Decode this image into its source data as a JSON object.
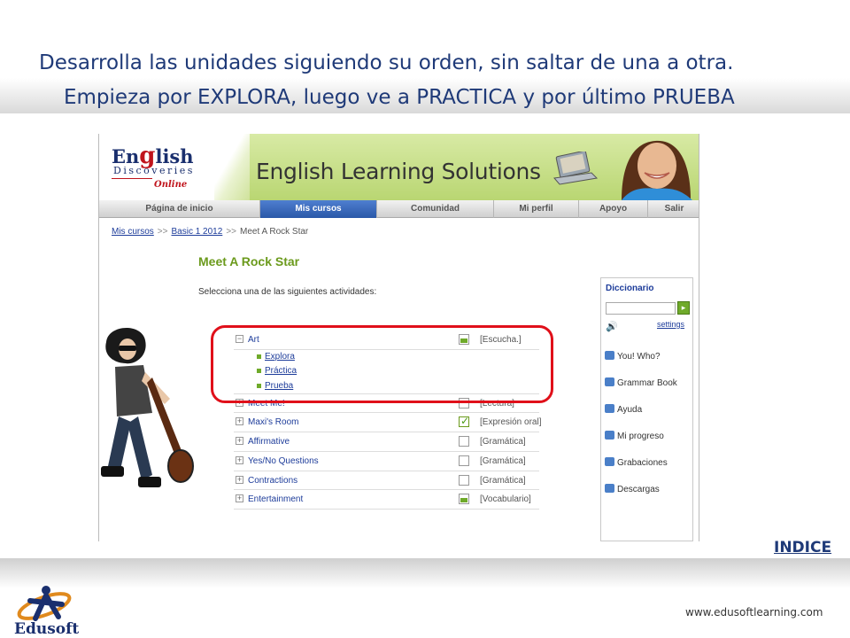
{
  "slide": {
    "title_line1": "Desarrolla las unidades siguiendo su orden, sin saltar de una a otra.",
    "title_line2": "Empieza por EXPLORA, luego ve a PRACTICA y por último PRUEBA",
    "indice": "INDICE",
    "url": "www.edusoftlearning.com",
    "edusoft_label": "Edusoft"
  },
  "header": {
    "logo_english_pre": "En",
    "logo_english_g": "g",
    "logo_english_post": "lish",
    "logo_discoveries": "Discoveries",
    "logo_online": "Online",
    "title": "English Learning Solutions"
  },
  "nav": [
    {
      "label": "Página de inicio",
      "active": false
    },
    {
      "label": "Mis cursos",
      "active": true
    },
    {
      "label": "Comunidad",
      "active": false
    },
    {
      "label": "Mi perfil",
      "active": false
    },
    {
      "label": "Apoyo",
      "active": false
    },
    {
      "label": "Salir",
      "active": false
    }
  ],
  "breadcrumb": {
    "link1": "Mis cursos",
    "sep": ">>",
    "link2": "Basic 1 2012",
    "current": "Meet A Rock Star"
  },
  "page": {
    "title": "Meet A Rock Star",
    "intro": "Selecciona una de las siguientes actividades:"
  },
  "activities": [
    {
      "name": "Art",
      "expander": "−",
      "status": "part",
      "type": "[Escucha.]",
      "subs": [
        "Explora",
        "Práctica",
        "Prueba"
      ]
    },
    {
      "name": "Meet Me!",
      "expander": "+",
      "status": "empty",
      "type": "[Lectura]"
    },
    {
      "name": "Maxi's Room",
      "expander": "+",
      "status": "check",
      "type": "[Expresión oral]"
    },
    {
      "name": "Affirmative",
      "expander": "+",
      "status": "empty",
      "type": "[Gramática]"
    },
    {
      "name": "Yes/No Questions",
      "expander": "+",
      "status": "empty",
      "type": "[Gramática]"
    },
    {
      "name": "Contractions",
      "expander": "+",
      "status": "empty",
      "type": "[Gramática]"
    },
    {
      "name": "Entertainment",
      "expander": "+",
      "status": "part",
      "type": "[Vocabulario]"
    }
  ],
  "sidebar": {
    "title": "Diccionario",
    "go": "▸",
    "settings": "settings",
    "items": [
      {
        "label": "You! Who?",
        "icon": "chat-icon"
      },
      {
        "label": "Grammar Book",
        "icon": "book-icon"
      },
      {
        "label": "Ayuda",
        "icon": "help-icon"
      },
      {
        "label": "Mi progreso",
        "icon": "progress-icon"
      },
      {
        "label": "Grabaciones",
        "icon": "record-icon"
      },
      {
        "label": "Descargas",
        "icon": "download-icon"
      }
    ]
  },
  "colors": {
    "accent_green": "#6b9a1c",
    "link_blue": "#1d3c9a",
    "highlight_red": "#e0101a",
    "title_blue": "#1f3a78"
  }
}
